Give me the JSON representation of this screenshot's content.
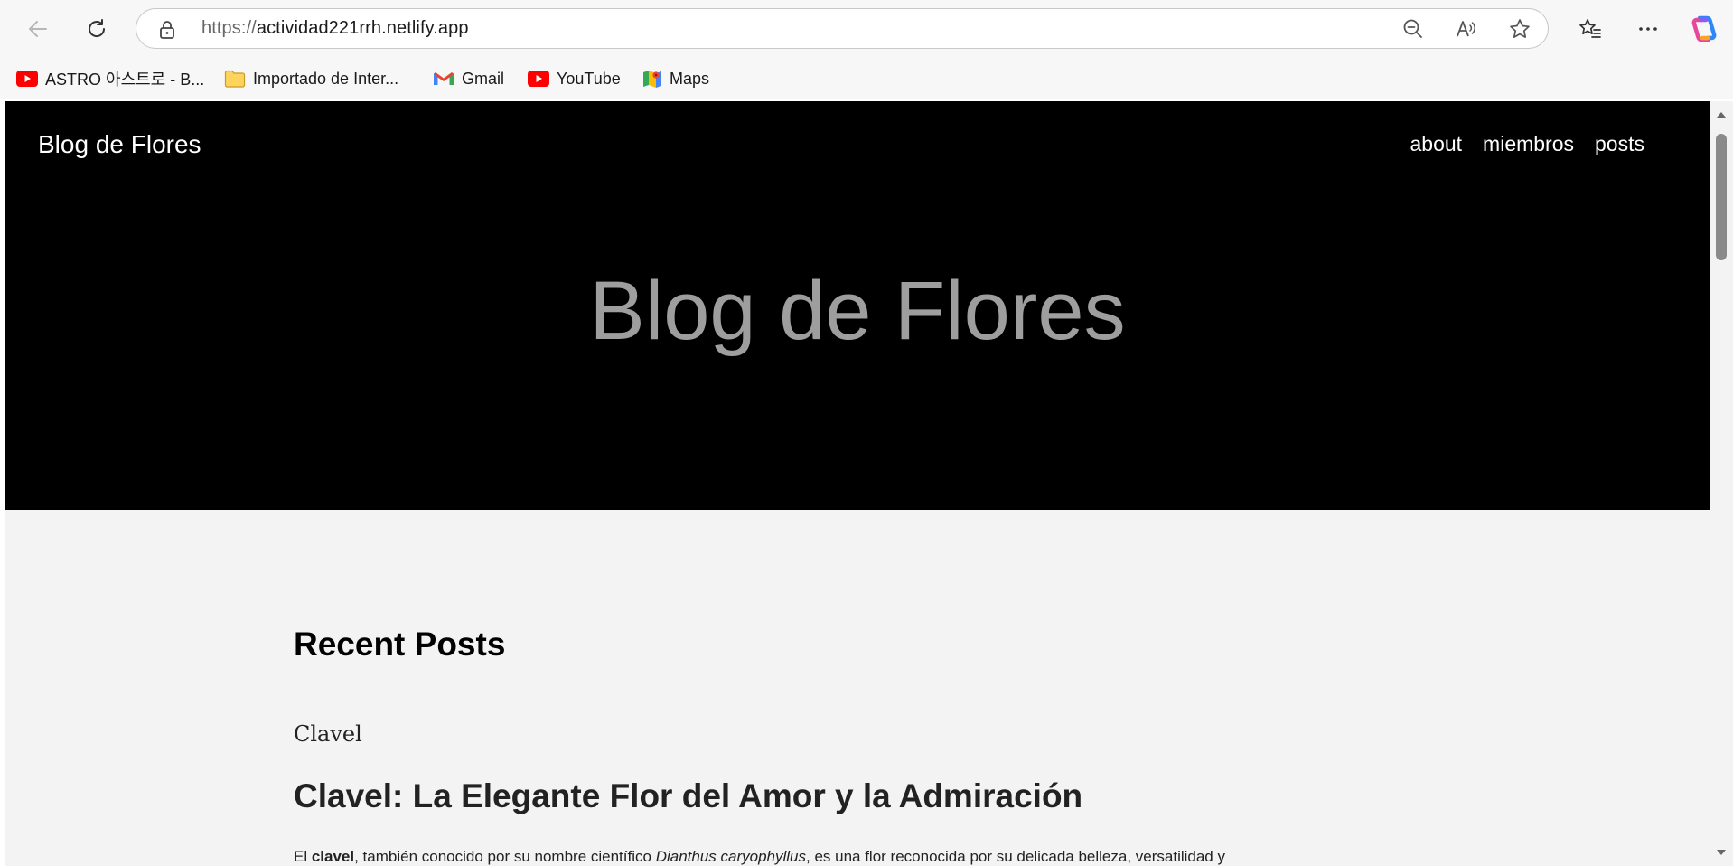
{
  "browser": {
    "url_protocol": "https://",
    "url_host": "actividad221rrh.netlify.app",
    "icons": {
      "back": "back-arrow-icon",
      "reload": "reload-icon",
      "lock": "lock-icon",
      "zoom_out": "zoom-out-icon",
      "read_aloud": "read-aloud-icon",
      "favorite": "star-icon",
      "favorites": "favorites-list-icon",
      "more": "ellipsis-icon",
      "copilot": "copilot-icon"
    }
  },
  "bookmarks": [
    {
      "label": "ASTRO 아스트로 - B...",
      "icon": "youtube-icon"
    },
    {
      "label": "Importado de Inter...",
      "icon": "folder-icon"
    },
    {
      "label": "Gmail",
      "icon": "gmail-icon"
    },
    {
      "label": "YouTube",
      "icon": "youtube-icon"
    },
    {
      "label": "Maps",
      "icon": "maps-icon"
    }
  ],
  "site": {
    "title": "Blog de Flores",
    "nav": [
      "about",
      "miembros",
      "posts"
    ],
    "hero_title": "Blog de Flores"
  },
  "main": {
    "section_heading": "Recent Posts",
    "post": {
      "tag": "Clavel",
      "title": "Clavel: La Elegante Flor del Amor y la Admiración",
      "body_prefix": "El ",
      "body_bold": "clavel",
      "body_mid": ", también conocido por su nombre científico ",
      "body_italic": "Dianthus caryophyllus",
      "body_suffix": ", es una flor reconocida por su delicada belleza, versatilidad y"
    }
  },
  "colors": {
    "hero_bg": "#000000",
    "hero_title": "#9e9e9e",
    "page_bg": "#f3f3f3"
  }
}
